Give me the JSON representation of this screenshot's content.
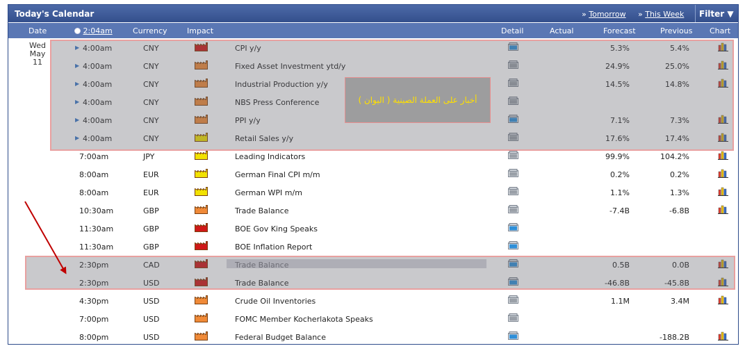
{
  "header": {
    "title": "Today's Calendar",
    "links": [
      {
        "prefix": "»",
        "label": "Tomorrow"
      },
      {
        "prefix": "»",
        "label": "This Week"
      }
    ],
    "filter_label": "Filter"
  },
  "columns": {
    "date": "Date",
    "time": "2:04am",
    "currency": "Currency",
    "impact": "Impact",
    "detail": "Detail",
    "actual": "Actual",
    "forecast": "Forecast",
    "previous": "Previous",
    "chart": "Chart"
  },
  "day": {
    "weekday": "Wed",
    "date": "May 11"
  },
  "annotation": "أخبار على العملة الصينية ( اليوان )",
  "colors": {
    "title_bar": "#3d5a98",
    "header_row": "#5a77b4",
    "high": "#d01818",
    "medium": "#f08a38",
    "low": "#f2e200",
    "annotation_text": "#ffe000",
    "arrow": "#c00000"
  },
  "rows": [
    {
      "time": "4:00am",
      "marker": "▶",
      "currency": "CNY",
      "impact": "high",
      "event": "CPI y/y",
      "detail": "new",
      "actual": "",
      "forecast": "5.3%",
      "previous": "5.4%",
      "chart": "bar-chart-icon"
    },
    {
      "time": "4:00am",
      "marker": "▶",
      "currency": "CNY",
      "impact": "medium",
      "event": "Fixed Asset Investment ytd/y",
      "detail": "read",
      "actual": "",
      "forecast": "24.9%",
      "previous": "25.0%",
      "chart": "bar-chart-icon"
    },
    {
      "time": "4:00am",
      "marker": "▶",
      "currency": "CNY",
      "impact": "medium",
      "event": "Industrial Production y/y",
      "detail": "read",
      "actual": "",
      "forecast": "14.5%",
      "previous": "14.8%",
      "chart": "bar-chart-icon"
    },
    {
      "time": "4:00am",
      "marker": "▶",
      "currency": "CNY",
      "impact": "medium",
      "event": "NBS Press Conference",
      "detail": "read",
      "actual": "",
      "forecast": "",
      "previous": "",
      "chart": ""
    },
    {
      "time": "4:00am",
      "marker": "▶",
      "currency": "CNY",
      "impact": "medium",
      "event": "PPI y/y",
      "detail": "new",
      "actual": "",
      "forecast": "7.1%",
      "previous": "7.3%",
      "chart": "bar-chart-icon"
    },
    {
      "time": "4:00am",
      "marker": "▶",
      "currency": "CNY",
      "impact": "low",
      "event": "Retail Sales y/y",
      "detail": "read",
      "actual": "",
      "forecast": "17.6%",
      "previous": "17.4%",
      "chart": "bar-chart-icon"
    },
    {
      "time": "7:00am",
      "marker": "",
      "currency": "JPY",
      "impact": "low",
      "event": "Leading Indicators",
      "detail": "read",
      "actual": "",
      "forecast": "99.9%",
      "previous": "104.2%",
      "chart": "bar-chart-icon"
    },
    {
      "time": "8:00am",
      "marker": "",
      "currency": "EUR",
      "impact": "low",
      "event": "German Final CPI m/m",
      "detail": "read",
      "actual": "",
      "forecast": "0.2%",
      "previous": "0.2%",
      "chart": "bar-chart-icon"
    },
    {
      "time": "8:00am",
      "marker": "",
      "currency": "EUR",
      "impact": "low",
      "event": "German WPI m/m",
      "detail": "read",
      "actual": "",
      "forecast": "1.1%",
      "previous": "1.3%",
      "chart": "bar-chart-icon"
    },
    {
      "time": "10:30am",
      "marker": "",
      "currency": "GBP",
      "impact": "medium",
      "event": "Trade Balance",
      "detail": "read",
      "actual": "",
      "forecast": "-7.4B",
      "previous": "-6.8B",
      "chart": "bar-chart-icon"
    },
    {
      "time": "11:30am",
      "marker": "",
      "currency": "GBP",
      "impact": "high",
      "event": "BOE Gov King Speaks",
      "detail": "new",
      "actual": "",
      "forecast": "",
      "previous": "",
      "chart": ""
    },
    {
      "time": "11:30am",
      "marker": "",
      "currency": "GBP",
      "impact": "high",
      "event": "BOE Inflation Report",
      "detail": "new",
      "actual": "",
      "forecast": "",
      "previous": "",
      "chart": ""
    },
    {
      "time": "2:30pm",
      "marker": "",
      "currency": "CAD",
      "impact": "high",
      "event": "Trade Balance",
      "detail": "new",
      "actual": "",
      "forecast": "0.5B",
      "previous": "0.0B",
      "chart": "bar-chart-icon"
    },
    {
      "time": "2:30pm",
      "marker": "",
      "currency": "USD",
      "impact": "high",
      "event": "Trade Balance",
      "detail": "new",
      "actual": "",
      "forecast": "-46.8B",
      "previous": "-45.8B",
      "chart": "bar-chart-icon"
    },
    {
      "time": "4:30pm",
      "marker": "",
      "currency": "USD",
      "impact": "medium",
      "event": "Crude Oil Inventories",
      "detail": "read",
      "actual": "",
      "forecast": "1.1M",
      "previous": "3.4M",
      "chart": "bar-chart-icon"
    },
    {
      "time": "7:00pm",
      "marker": "",
      "currency": "USD",
      "impact": "medium",
      "event": "FOMC Member Kocherlakota Speaks",
      "detail": "read",
      "actual": "",
      "forecast": "",
      "previous": "",
      "chart": ""
    },
    {
      "time": "8:00pm",
      "marker": "",
      "currency": "USD",
      "impact": "medium",
      "event": "Federal Budget Balance",
      "detail": "new",
      "actual": "",
      "forecast": "",
      "previous": "-188.2B",
      "chart": "bar-chart-icon"
    }
  ]
}
